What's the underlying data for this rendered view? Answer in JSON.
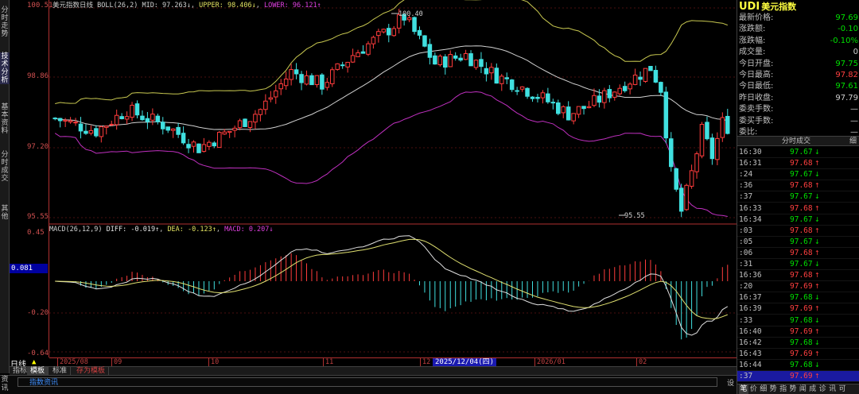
{
  "left_tabs": [
    "分时走势",
    "技术分析",
    "基本资料",
    "分时成交",
    "其他"
  ],
  "axis": {
    "price_labels": [
      "100.51",
      "98.86",
      "97.20",
      "95.55"
    ],
    "macd_labels": [
      "0.45",
      "-0.20",
      "-0.64"
    ],
    "macd_marker": "0.081"
  },
  "main_legend": {
    "title": "美元指数日线",
    "indicator": "BOLL(26,2)",
    "mid": "MID: 97.263↓",
    "upper": "UPPER: 98.406↓",
    "lower": "LOWER: 96.121↑"
  },
  "annotations": {
    "high": "100.40",
    "low": "95.55"
  },
  "macd_legend": {
    "indicator": "MACD(26,12,9)",
    "diff": "DIFF: -0.019↑",
    "dea": "DEA: -0.123↑",
    "macd": "MACD: 0.207↓"
  },
  "period": "日线",
  "date_ticks": [
    "2025/08",
    "09",
    "10",
    "11",
    "12",
    "2026/01",
    "02"
  ],
  "date_cursor": "2025/12/04(四)",
  "bottom_tabs": [
    "指标",
    "模板",
    "标准",
    "存为模板"
  ],
  "news": {
    "side": [
      "资",
      "讯"
    ],
    "title": "指数资讯",
    "settings": "设"
  },
  "quote": {
    "code": "UDI",
    "name": "美元指数",
    "rows": [
      {
        "label": "最新价格:",
        "value": "97.69",
        "color": "green"
      },
      {
        "label": "涨跌额:",
        "value": "-0.10",
        "color": "green"
      },
      {
        "label": "涨跌幅:",
        "value": "-0.10%",
        "color": "green"
      },
      {
        "label": "成交量:",
        "value": "0",
        "color": "white"
      },
      {
        "label": "今日开盘:",
        "value": "97.75",
        "color": "green"
      },
      {
        "label": "今日最高:",
        "value": "97.82",
        "color": "red"
      },
      {
        "label": "今日最低:",
        "value": "97.61",
        "color": "green"
      },
      {
        "label": "昨日收盘:",
        "value": "97.79",
        "color": "white"
      },
      {
        "label": "委卖手数:",
        "value": "—",
        "color": "white"
      },
      {
        "label": "委买手数:",
        "value": "—",
        "color": "white"
      },
      {
        "label": "委比:",
        "value": "—",
        "color": "white"
      }
    ]
  },
  "trades": {
    "title": "分时成交",
    "detail": "细",
    "rows": [
      {
        "time": "16:30",
        "price": "97.67",
        "dir": "down"
      },
      {
        "time": "16:31",
        "price": "97.68",
        "dir": "up"
      },
      {
        "time": ":24",
        "price": "97.67",
        "dir": "down"
      },
      {
        "time": ":36",
        "price": "97.68",
        "dir": "up"
      },
      {
        "time": ":37",
        "price": "97.67",
        "dir": "down"
      },
      {
        "time": "16:33",
        "price": "97.68",
        "dir": "up"
      },
      {
        "time": "16:34",
        "price": "97.67",
        "dir": "down"
      },
      {
        "time": ":03",
        "price": "97.68",
        "dir": "up"
      },
      {
        "time": ":05",
        "price": "97.67",
        "dir": "down"
      },
      {
        "time": ":06",
        "price": "97.68",
        "dir": "up"
      },
      {
        "time": ":31",
        "price": "97.67",
        "dir": "down"
      },
      {
        "time": "16:36",
        "price": "97.68",
        "dir": "up"
      },
      {
        "time": ":20",
        "price": "97.69",
        "dir": "up"
      },
      {
        "time": "16:37",
        "price": "97.68",
        "dir": "down"
      },
      {
        "time": "16:39",
        "price": "97.69",
        "dir": "up"
      },
      {
        "time": ":33",
        "price": "97.68",
        "dir": "down"
      },
      {
        "time": "16:40",
        "price": "97.69",
        "dir": "up"
      },
      {
        "time": "16:42",
        "price": "97.68",
        "dir": "down"
      },
      {
        "time": "16:43",
        "price": "97.69",
        "dir": "up"
      },
      {
        "time": "16:44",
        "price": "97.68",
        "dir": "down"
      },
      {
        "time": ":37",
        "price": "97.69",
        "dir": "up"
      }
    ]
  },
  "right_tabs": [
    "笔",
    "价",
    "细",
    "势",
    "指",
    "势",
    "闻",
    "成",
    "诊",
    "讯",
    "可"
  ],
  "colors": {
    "up": "#ff3c3c",
    "down": "#40e0e0",
    "mid": "#d0d0d0",
    "upper": "#c8c850",
    "lower": "#c030c0",
    "diff": "#e0e0e0",
    "dea": "#e0e070"
  }
}
